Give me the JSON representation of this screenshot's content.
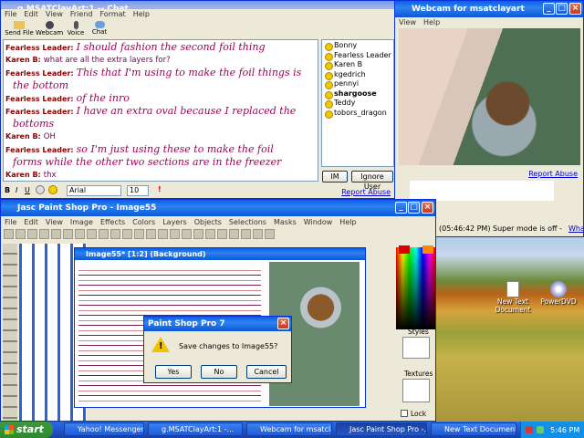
{
  "chat": {
    "title": "g.MSATClayArt:1 -- Chat",
    "menu": [
      "File",
      "Edit",
      "View",
      "Friend",
      "Format",
      "Help"
    ],
    "toolbar": [
      "Send File",
      "Webcam",
      "Voice",
      "Chat"
    ],
    "messages": [
      {
        "name": "Fearless Leader:",
        "text": "I should fashion the second foil thing",
        "style": "hand"
      },
      {
        "name": "Karen B:",
        "text": "what are all the extra layers for?",
        "style": "plain"
      },
      {
        "name": "Fearless Leader:",
        "text": "This that I'm using to make the foil things is",
        "style": "hand"
      },
      {
        "name": "",
        "text": "the bottom",
        "style": "hand"
      },
      {
        "name": "Fearless Leader:",
        "text": "of the inro",
        "style": "hand"
      },
      {
        "name": "Fearless Leader:",
        "text": "I have an extra oval because I replaced the",
        "style": "hand"
      },
      {
        "name": "",
        "text": "bottoms",
        "style": "hand"
      },
      {
        "name": "Karen B:",
        "text": "OH",
        "style": "plain"
      },
      {
        "name": "Fearless Leader:",
        "text": "so I'm just using these to make the foil",
        "style": "hand"
      },
      {
        "name": "",
        "text": "forms while the other two sections are in the freezer",
        "style": "hand"
      },
      {
        "name": "Karen B:",
        "text": "thx",
        "style": "plain"
      }
    ],
    "buddies": [
      "Bonny",
      "Fearless Leader",
      "Karen B",
      "kgedrich",
      "pennyi",
      "shargoose",
      "Teddy",
      "tobors_dragon"
    ],
    "im_label": "IM",
    "ignore_label": "Ignore User",
    "report_abuse": "Report Abuse",
    "font_name": "Arial",
    "font_size": "10"
  },
  "webcam": {
    "title": "Webcam for msatclayart",
    "menu": [
      "View",
      "Help"
    ],
    "report_abuse": "Report Abuse",
    "time": "(05:46:42 PM)",
    "super_mode": "Super mode is off -",
    "whats_this": "What's this?"
  },
  "psp": {
    "title": "Jasc Paint Shop Pro - Image55",
    "menu": [
      "File",
      "Edit",
      "View",
      "Image",
      "Effects",
      "Colors",
      "Layers",
      "Objects",
      "Selections",
      "Masks",
      "Window",
      "Help"
    ],
    "inner_title": "Image55* [1:2] (Background)",
    "styles": "Styles",
    "textures": "Textures",
    "lock": "Lock"
  },
  "dialog": {
    "title": "Paint Shop Pro 7",
    "message": "Save changes to Image55?",
    "yes": "Yes",
    "no": "No",
    "cancel": "Cancel"
  },
  "desktop": {
    "icon1": "New Text Document",
    "icon2": "PowerDVD"
  },
  "taskbar": {
    "start": "start",
    "time": "5:46 PM",
    "items": [
      "Yahoo! Messenger (I...",
      "g.MSATClayArt:1 -...",
      "Webcam for msatclay...",
      "Jasc Paint Shop Pro -...",
      "New Text Document ..."
    ]
  }
}
